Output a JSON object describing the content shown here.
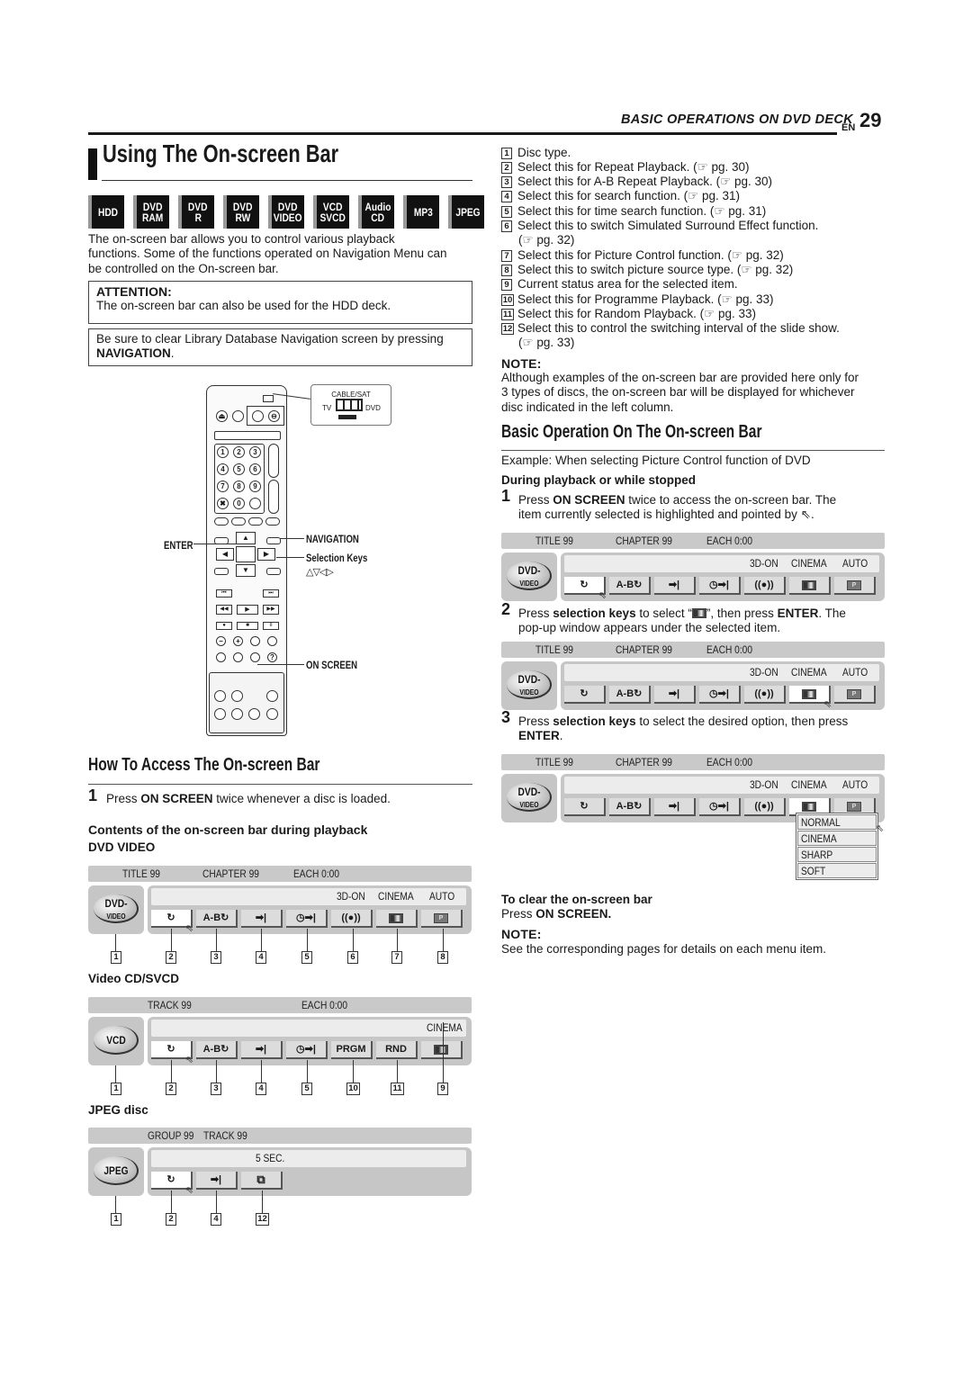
{
  "header": {
    "section": "BASIC OPERATIONS ON DVD DECK",
    "lang": "EN",
    "page_number": "29"
  },
  "title": "Using The On-screen Bar",
  "disc_badges": [
    {
      "line1": "HDD",
      "line2": ""
    },
    {
      "line1": "DVD",
      "line2": "RAM"
    },
    {
      "line1": "DVD",
      "line2": "R"
    },
    {
      "line1": "DVD",
      "line2": "RW"
    },
    {
      "line1": "DVD",
      "line2": "VIDEO"
    },
    {
      "line1": "VCD",
      "line2": "SVCD"
    },
    {
      "line1": "Audio",
      "line2": "CD"
    },
    {
      "line1": "MP3",
      "line2": ""
    },
    {
      "line1": "JPEG",
      "line2": ""
    }
  ],
  "intro": {
    "line1": "The on-screen bar allows you to control various playback",
    "line2": "functions. Some of the functions operated on Navigation Menu can",
    "line3": "be controlled on the On-screen bar."
  },
  "attention": {
    "heading": "ATTENTION:",
    "text": "The on-screen bar can also be used for the HDD deck."
  },
  "notice": {
    "text": "Be sure to clear Library Database Navigation screen by pressing",
    "bold": "NAVIGATION",
    "tail": "."
  },
  "remote": {
    "inset_label": "CABLE/SAT",
    "inset_left": "TV",
    "inset_right": "DVD",
    "enter_label": "ENTER",
    "navigation_label": "NAVIGATION",
    "selection_label": "Selection Keys",
    "selection_glyphs": "△▽◁▷",
    "on_screen_label": "ON SCREEN",
    "number_keys": [
      "1",
      "2",
      "3",
      "4",
      "5",
      "6",
      "7",
      "8",
      "9",
      "✖",
      "0",
      ""
    ]
  },
  "how_to": {
    "heading": "How To Access The On-screen Bar",
    "step_number": "1",
    "step_pre": "Press ",
    "step_bold": "ON SCREEN",
    "step_post": " twice whenever a disc is loaded.",
    "contents_heading": "Contents of the on-screen bar during playback"
  },
  "bars": {
    "dvd": {
      "label": "DVD VIDEO",
      "top": [
        "TITLE 99",
        "CHAPTER 99",
        "EACH 0:00"
      ],
      "status": [
        "3D-ON",
        "CINEMA",
        "AUTO"
      ],
      "disc_line1": "DVD-",
      "disc_line2": "VIDEO",
      "buttons": [
        "↻",
        "A-B↻",
        "➡|",
        "◷➡|",
        "((●))",
        "pic",
        "src"
      ],
      "callouts": [
        "1",
        "2",
        "3",
        "4",
        "5",
        "6",
        "7",
        "8"
      ]
    },
    "vcd": {
      "label": "Video CD/SVCD",
      "top": [
        "TRACK 99",
        "EACH 0:00"
      ],
      "status": [
        "CINEMA"
      ],
      "disc_line1": "VCD",
      "buttons": [
        "↻",
        "A-B↻",
        "➡|",
        "◷➡|",
        "PRGM",
        "RND",
        "pic"
      ],
      "callouts": [
        "1",
        "2",
        "3",
        "4",
        "5",
        "10",
        "11",
        "9"
      ]
    },
    "jpeg": {
      "label": "JPEG disc",
      "top": [
        "GROUP 99",
        "TRACK 99"
      ],
      "status": [
        "5 SEC."
      ],
      "disc_line1": "JPEG",
      "buttons": [
        "↻",
        "➡|",
        "slides"
      ],
      "callouts": [
        "1",
        "2",
        "4",
        "12"
      ]
    }
  },
  "legend": [
    {
      "n": "1",
      "text": "Disc type.",
      "ref": ""
    },
    {
      "n": "2",
      "text": "Select this for Repeat Playback.",
      "ref": "(☞ pg. 30)"
    },
    {
      "n": "3",
      "text": "Select this for A-B Repeat Playback.",
      "ref": "(☞ pg. 30)"
    },
    {
      "n": "4",
      "text": "Select this for search function.",
      "ref": "(☞ pg. 31)"
    },
    {
      "n": "5",
      "text": "Select this for time search function.",
      "ref": "(☞ pg. 31)"
    },
    {
      "n": "6",
      "text": "Select this to switch Simulated Surround Effect function.",
      "ref": "(☞ pg. 32)"
    },
    {
      "n": "7",
      "text": "Select this for Picture Control function.",
      "ref": "(☞ pg. 32)"
    },
    {
      "n": "8",
      "text": "Select this to switch picture source type.",
      "ref": "(☞ pg. 32)"
    },
    {
      "n": "9",
      "text": "Current status area for the selected item.",
      "ref": ""
    },
    {
      "n": "10",
      "text": "Select this for Programme Playback.",
      "ref": "(☞ pg. 33)"
    },
    {
      "n": "11",
      "text": "Select this for Random Playback.",
      "ref": "(☞ pg. 33)"
    },
    {
      "n": "12",
      "text": "Select this to control the switching interval of the slide show.",
      "ref": "(☞ pg. 33)"
    }
  ],
  "note1": {
    "heading": "NOTE:",
    "line1": "Although examples of the on-screen bar are provided here only for",
    "line2": "3 types of discs, the on-screen bar will be displayed for whichever",
    "line3": "disc indicated in the left column."
  },
  "basic_op": {
    "heading": "Basic Operation On The On-screen Bar",
    "example": "Example: When selecting Picture Control function of DVD",
    "during": "During playback or while stopped",
    "step1_num": "1",
    "step1_pre": "Press ",
    "step1_bold": "ON SCREEN",
    "step1_post": " twice to access the on-screen bar. The",
    "step1_line2": "item currently selected is highlighted and pointed by ⇖.",
    "step2_num": "2",
    "step2_pre": "Press ",
    "step2_bold": "selection keys",
    "step2_mid": " to select “",
    "step2_post": "”, then press ",
    "step2_bold2": "ENTER",
    "step2_tail": ". The",
    "step2_line2": "pop-up window appears under the selected item.",
    "step3_num": "3",
    "step3_pre": "Press ",
    "step3_bold": "selection keys",
    "step3_post": " to select the desired option, then press",
    "step3_bold2": "ENTER",
    "step3_tail": ".",
    "popup_options": [
      "NORMAL",
      "CINEMA",
      "SHARP",
      "SOFT"
    ]
  },
  "clear": {
    "heading": "To clear the on-screen bar",
    "pre": "Press ",
    "bold": "ON SCREEN."
  },
  "note2": {
    "heading": "NOTE:",
    "text": "See the corresponding pages for details on each menu item."
  }
}
